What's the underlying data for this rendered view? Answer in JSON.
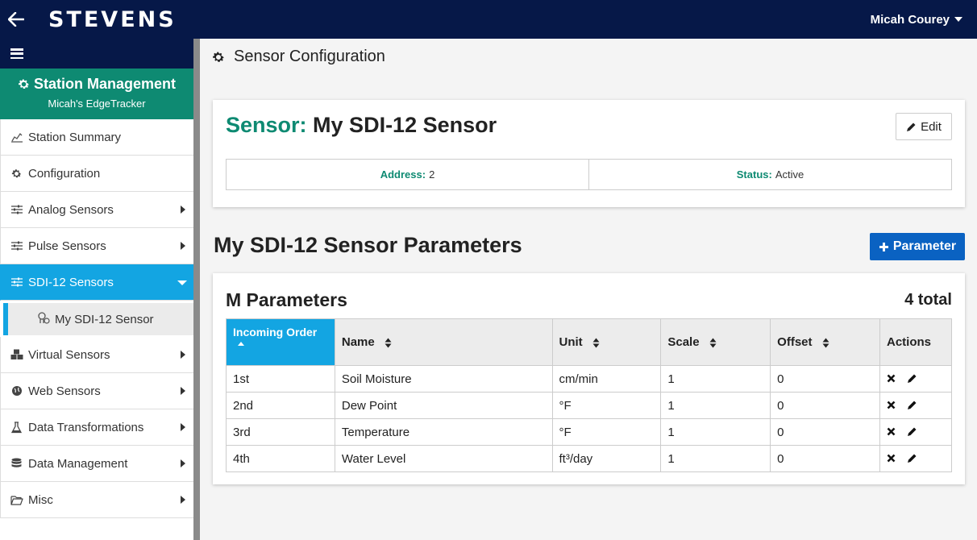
{
  "header": {
    "logo_text": "STEVENS",
    "user_name": "Micah Courey"
  },
  "sidebar": {
    "station_title": "Station Management",
    "station_name": "Micah's EdgeTracker",
    "items": [
      {
        "label": "Station Summary",
        "icon": "chart-icon"
      },
      {
        "label": "Configuration",
        "icon": "gear-icon"
      },
      {
        "label": "Analog Sensors",
        "icon": "sliders-icon"
      },
      {
        "label": "Pulse Sensors",
        "icon": "sliders-icon"
      },
      {
        "label": "SDI-12 Sensors",
        "icon": "sliders-icon",
        "active": true
      },
      {
        "label": "Virtual Sensors",
        "icon": "cubes-icon"
      },
      {
        "label": "Web Sensors",
        "icon": "globe-icon"
      },
      {
        "label": "Data Transformations",
        "icon": "flask-icon"
      },
      {
        "label": "Data Management",
        "icon": "database-icon"
      },
      {
        "label": "Misc",
        "icon": "folder-icon"
      }
    ],
    "subitem": "My SDI-12 Sensor"
  },
  "page": {
    "title": "Sensor Configuration"
  },
  "sensor": {
    "label": "Sensor:",
    "name": "My SDI-12 Sensor",
    "edit_label": "Edit",
    "address_label": "Address:",
    "address_value": "2",
    "status_label": "Status:",
    "status_value": "Active"
  },
  "parameters": {
    "title": "My SDI-12 Sensor Parameters",
    "add_label": "Parameter",
    "group_title": "M Parameters",
    "total": "4 total",
    "columns": [
      "Incoming Order",
      "Name",
      "Unit",
      "Scale",
      "Offset",
      "Actions"
    ],
    "rows": [
      {
        "order": "1st",
        "name": "Soil Moisture",
        "unit": "cm/min",
        "scale": "1",
        "offset": "0"
      },
      {
        "order": "2nd",
        "name": "Dew Point",
        "unit": "°F",
        "scale": "1",
        "offset": "0"
      },
      {
        "order": "3rd",
        "name": "Temperature",
        "unit": "°F",
        "scale": "1",
        "offset": "0"
      },
      {
        "order": "4th",
        "name": "Water Level",
        "unit": "ft³/day",
        "scale": "1",
        "offset": "0"
      }
    ]
  },
  "colors": {
    "navy": "#061848",
    "teal": "#0e8a72",
    "active_blue": "#13a5e2",
    "button_blue": "#0a62c2"
  }
}
